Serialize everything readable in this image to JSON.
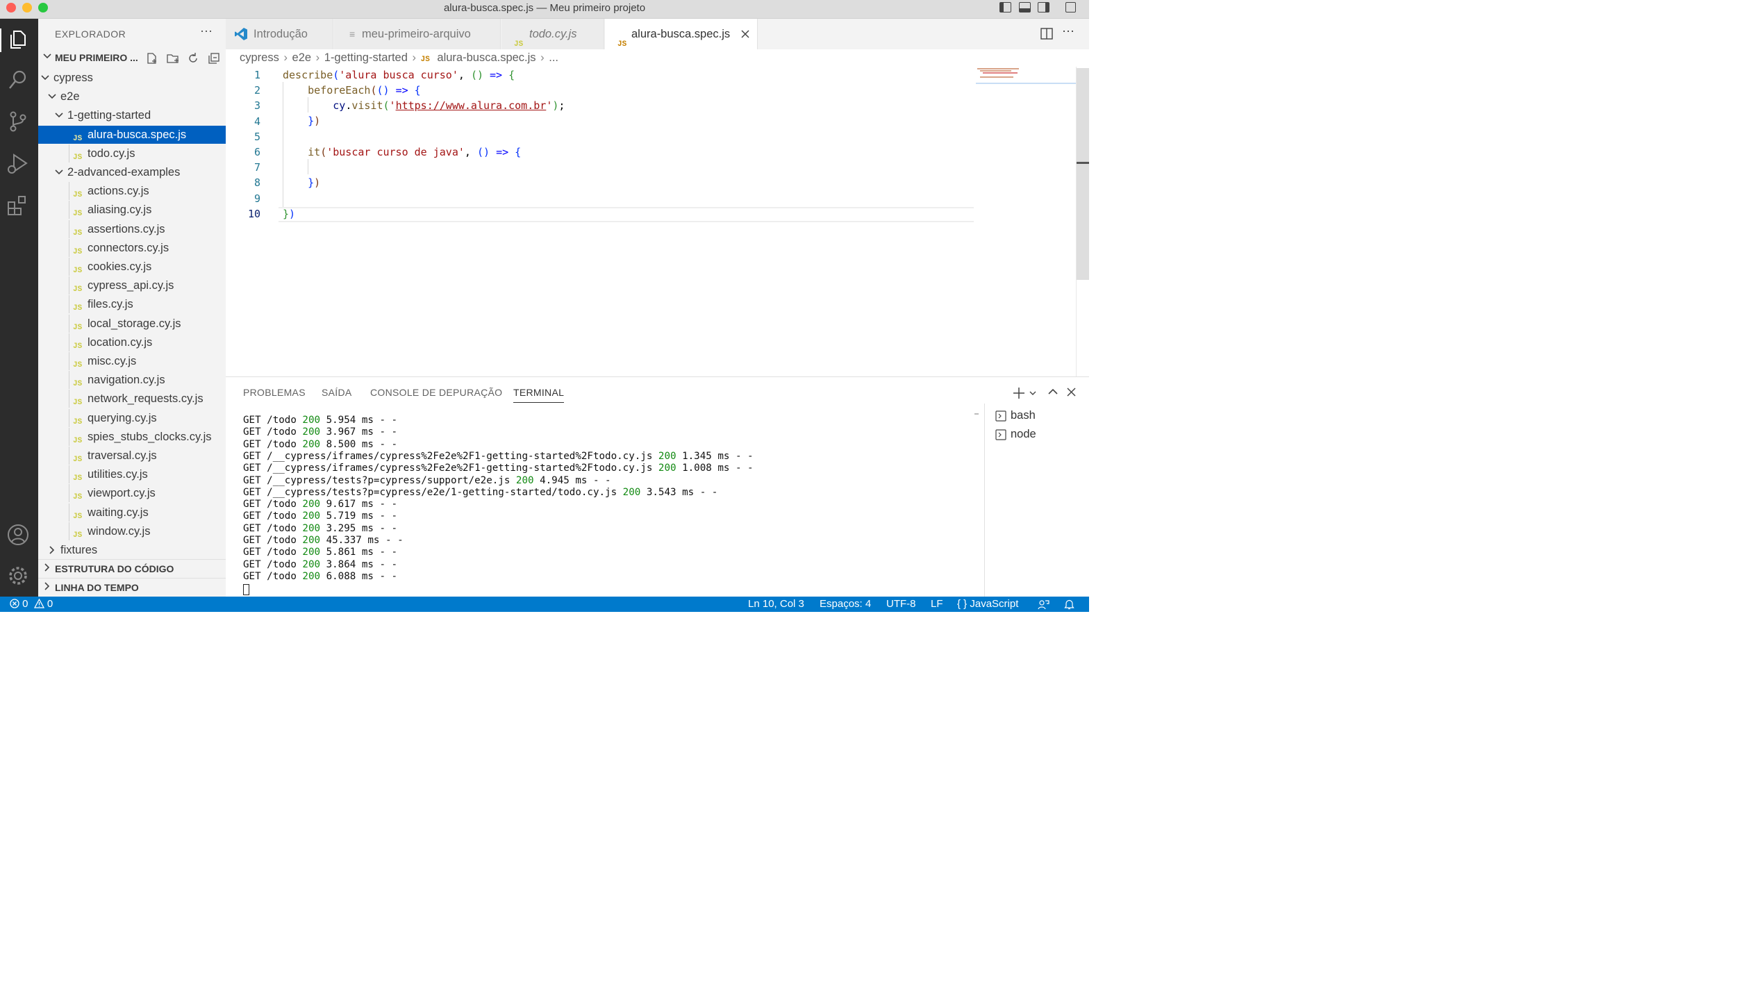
{
  "window": {
    "title": "alura-busca.spec.js — Meu primeiro projeto"
  },
  "sidebar": {
    "header": "EXPLORADOR",
    "project": "MEU PRIMEIRO ...",
    "tree": [
      {
        "label": "cypress",
        "kind": "folder",
        "depth": 1,
        "open": true
      },
      {
        "label": "e2e",
        "kind": "folder",
        "depth": 2,
        "open": true
      },
      {
        "label": "1-getting-started",
        "kind": "folder",
        "depth": 3,
        "open": true
      },
      {
        "label": "alura-busca.spec.js",
        "kind": "file",
        "depth": 4,
        "selected": true
      },
      {
        "label": "todo.cy.js",
        "kind": "file",
        "depth": 4
      },
      {
        "label": "2-advanced-examples",
        "kind": "folder",
        "depth": 3,
        "open": true
      },
      {
        "label": "actions.cy.js",
        "kind": "file",
        "depth": 4
      },
      {
        "label": "aliasing.cy.js",
        "kind": "file",
        "depth": 4
      },
      {
        "label": "assertions.cy.js",
        "kind": "file",
        "depth": 4
      },
      {
        "label": "connectors.cy.js",
        "kind": "file",
        "depth": 4
      },
      {
        "label": "cookies.cy.js",
        "kind": "file",
        "depth": 4
      },
      {
        "label": "cypress_api.cy.js",
        "kind": "file",
        "depth": 4
      },
      {
        "label": "files.cy.js",
        "kind": "file",
        "depth": 4
      },
      {
        "label": "local_storage.cy.js",
        "kind": "file",
        "depth": 4
      },
      {
        "label": "location.cy.js",
        "kind": "file",
        "depth": 4
      },
      {
        "label": "misc.cy.js",
        "kind": "file",
        "depth": 4
      },
      {
        "label": "navigation.cy.js",
        "kind": "file",
        "depth": 4
      },
      {
        "label": "network_requests.cy.js",
        "kind": "file",
        "depth": 4
      },
      {
        "label": "querying.cy.js",
        "kind": "file",
        "depth": 4
      },
      {
        "label": "spies_stubs_clocks.cy.js",
        "kind": "file",
        "depth": 4
      },
      {
        "label": "traversal.cy.js",
        "kind": "file",
        "depth": 4
      },
      {
        "label": "utilities.cy.js",
        "kind": "file",
        "depth": 4
      },
      {
        "label": "viewport.cy.js",
        "kind": "file",
        "depth": 4
      },
      {
        "label": "waiting.cy.js",
        "kind": "file",
        "depth": 4
      },
      {
        "label": "window.cy.js",
        "kind": "file",
        "depth": 4
      },
      {
        "label": "fixtures",
        "kind": "folder",
        "depth": 2,
        "open": false
      }
    ],
    "sections": [
      "ESTRUTURA DO CÓDIGO",
      "LINHA DO TEMPO"
    ]
  },
  "tabs": [
    {
      "label": "Introdução",
      "icon": "vscode-logo-icon"
    },
    {
      "label": "meu-primeiro-arquivo",
      "icon": "text-file-icon"
    },
    {
      "label": "todo.cy.js",
      "icon": "js-file-icon",
      "italic": true
    },
    {
      "label": "alura-busca.spec.js",
      "icon": "js-file-icon",
      "active": true
    }
  ],
  "breadcrumb": [
    "cypress",
    "e2e",
    "1-getting-started",
    "alura-busca.spec.js",
    "..."
  ],
  "editor": {
    "line_numbers": [
      "1",
      "2",
      "3",
      "4",
      "5",
      "6",
      "7",
      "8",
      "9",
      "10"
    ],
    "code": {
      "l1_fn": "describe",
      "l1_str": "'alura busca curso'",
      "l2_fn": "beforeEach",
      "l3_obj": "cy",
      "l3_fn": "visit",
      "l3_url": "https://www.alura.com.br",
      "l6_fn": "it",
      "l6_str": "'buscar curso de java'"
    }
  },
  "panel": {
    "tabs": [
      "PROBLEMAS",
      "SAÍDA",
      "CONSOLE DE DEPURAÇÃO",
      "TERMINAL"
    ],
    "active_tab": "TERMINAL",
    "terminal_lines": [
      {
        "pre": "GET /todo ",
        "status": "200",
        "post": " 5.954 ms - -"
      },
      {
        "pre": "GET /todo ",
        "status": "200",
        "post": " 3.967 ms - -"
      },
      {
        "pre": "GET /todo ",
        "status": "200",
        "post": " 8.500 ms - -"
      },
      {
        "pre": "GET /__cypress/iframes/cypress%2Fe2e%2F1-getting-started%2Ftodo.cy.js ",
        "status": "200",
        "post": " 1.345 ms - -"
      },
      {
        "pre": "GET /__cypress/iframes/cypress%2Fe2e%2F1-getting-started%2Ftodo.cy.js ",
        "status": "200",
        "post": " 1.008 ms - -"
      },
      {
        "pre": "GET /__cypress/tests?p=cypress/support/e2e.js ",
        "status": "200",
        "post": " 4.945 ms - -"
      },
      {
        "pre": "GET /__cypress/tests?p=cypress/e2e/1-getting-started/todo.cy.js ",
        "status": "200",
        "post": " 3.543 ms - -"
      },
      {
        "pre": "GET /todo ",
        "status": "200",
        "post": " 9.617 ms - -"
      },
      {
        "pre": "GET /todo ",
        "status": "200",
        "post": " 5.719 ms - -"
      },
      {
        "pre": "GET /todo ",
        "status": "200",
        "post": " 3.295 ms - -"
      },
      {
        "pre": "GET /todo ",
        "status": "200",
        "post": " 45.337 ms - -"
      },
      {
        "pre": "GET /todo ",
        "status": "200",
        "post": " 5.861 ms - -"
      },
      {
        "pre": "GET /todo ",
        "status": "200",
        "post": " 3.864 ms - -"
      },
      {
        "pre": "GET /todo ",
        "status": "200",
        "post": " 6.088 ms - -"
      }
    ],
    "terminals": [
      "bash",
      "node"
    ]
  },
  "statusbar": {
    "errors": "0",
    "warnings": "0",
    "position": "Ln 10, Col 3",
    "indent": "Espaços: 4",
    "encoding": "UTF-8",
    "eol": "LF",
    "language": "JavaScript"
  },
  "colors": {
    "accent": "#007acc",
    "selection": "#0060c0",
    "status_green": "#128a12"
  }
}
